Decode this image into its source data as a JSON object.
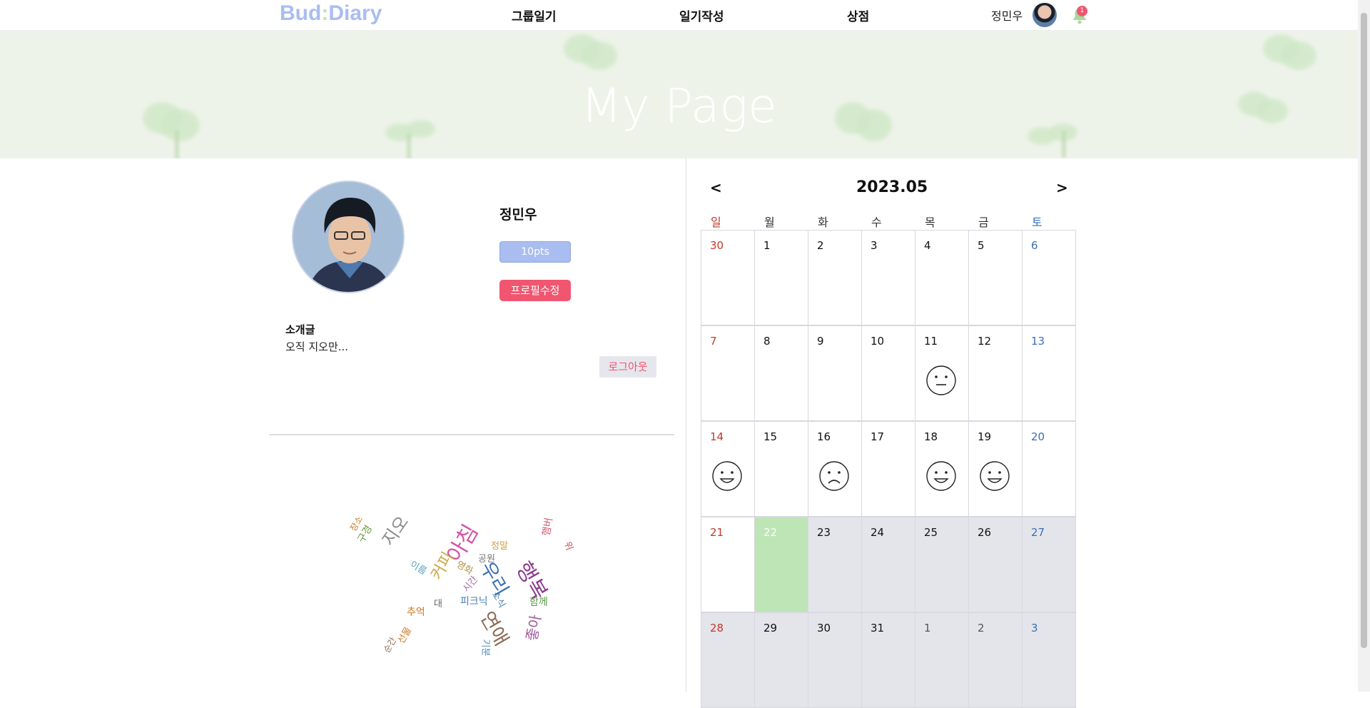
{
  "nav": {
    "logo_left": "Bud",
    "logo_colon": ":",
    "logo_right": "Diary",
    "links": [
      "그룹일기",
      "일기작성",
      "상점"
    ],
    "user_name": "정민우",
    "notification_count": "1"
  },
  "banner": {
    "title": "My Page"
  },
  "profile": {
    "name": "정민우",
    "points": "10pts",
    "edit_label": "프로필수정",
    "intro_heading": "소개글",
    "intro_text": "오직 지오만...",
    "logout_label": "로그아웃"
  },
  "word_cloud": [
    {
      "text": "행복",
      "color": "#8a3b8f"
    },
    {
      "text": "아침",
      "color": "#d455a6"
    },
    {
      "text": "우리",
      "color": "#3a6fb5"
    },
    {
      "text": "연애",
      "color": "#8c6a54"
    },
    {
      "text": "지오",
      "color": "#8a8a8a"
    },
    {
      "text": "커피",
      "color": "#c9a84a"
    },
    {
      "text": "좋아",
      "color": "#a05a9a"
    },
    {
      "text": "피크닉",
      "color": "#4a7fb5"
    },
    {
      "text": "함께",
      "color": "#5a9a4a"
    },
    {
      "text": "추억",
      "color": "#c97a2a"
    },
    {
      "text": "공원",
      "color": "#777777"
    },
    {
      "text": "영화",
      "color": "#b09040"
    },
    {
      "text": "정말",
      "color": "#c9a040"
    },
    {
      "text": "시간",
      "color": "#a06aa0"
    },
    {
      "text": "구경",
      "color": "#6a9a3a"
    },
    {
      "text": "선물",
      "color": "#c97a2a"
    },
    {
      "text": "이름",
      "color": "#5aa0c0"
    },
    {
      "text": "대",
      "color": "#666666"
    },
    {
      "text": "기분",
      "color": "#4a8ac0"
    },
    {
      "text": "소식",
      "color": "#4a7fb5"
    },
    {
      "text": "햄버",
      "color": "#d4607a"
    },
    {
      "text": "위",
      "color": "#c05050"
    },
    {
      "text": "장소",
      "color": "#c97a2a"
    },
    {
      "text": "순간",
      "color": "#8c6a54"
    }
  ],
  "calendar": {
    "prev": "<",
    "next": ">",
    "title": "2023.05",
    "weekdays": [
      "일",
      "월",
      "화",
      "수",
      "목",
      "금",
      "토"
    ],
    "weeks": [
      [
        {
          "d": "30",
          "m": "prev"
        },
        {
          "d": "1"
        },
        {
          "d": "2"
        },
        {
          "d": "3"
        },
        {
          "d": "4"
        },
        {
          "d": "5"
        },
        {
          "d": "6"
        }
      ],
      [
        {
          "d": "7"
        },
        {
          "d": "8"
        },
        {
          "d": "9"
        },
        {
          "d": "10"
        },
        {
          "d": "11",
          "mood": "neutral"
        },
        {
          "d": "12"
        },
        {
          "d": "13"
        }
      ],
      [
        {
          "d": "14",
          "mood": "happy"
        },
        {
          "d": "15"
        },
        {
          "d": "16",
          "mood": "sad"
        },
        {
          "d": "17"
        },
        {
          "d": "18",
          "mood": "happy"
        },
        {
          "d": "19",
          "mood": "happy"
        },
        {
          "d": "20"
        }
      ],
      [
        {
          "d": "21"
        },
        {
          "d": "22",
          "today": true
        },
        {
          "d": "23",
          "grey": true
        },
        {
          "d": "24",
          "grey": true
        },
        {
          "d": "25",
          "grey": true
        },
        {
          "d": "26",
          "grey": true
        },
        {
          "d": "27",
          "grey": true
        }
      ],
      [
        {
          "d": "28",
          "grey": true
        },
        {
          "d": "29",
          "grey": true
        },
        {
          "d": "30",
          "grey": true
        },
        {
          "d": "31",
          "grey": true
        },
        {
          "d": "1",
          "grey": true,
          "m": "next"
        },
        {
          "d": "2",
          "grey": true,
          "m": "next"
        },
        {
          "d": "3",
          "grey": true,
          "m": "next"
        }
      ]
    ],
    "colors": {
      "sunday": "#c0392b",
      "saturday": "#3a6fb5",
      "today": "#bde5b6",
      "future": "#e4e5ea"
    }
  }
}
